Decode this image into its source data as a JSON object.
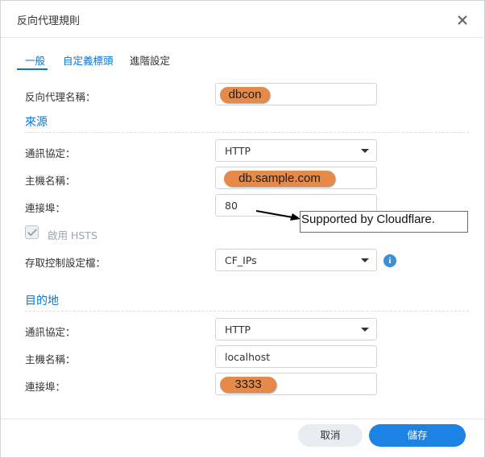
{
  "dialog": {
    "title": "反向代理規則",
    "close_icon": "close-icon"
  },
  "tabs": [
    {
      "label": "一般",
      "active": true
    },
    {
      "label": "自定義標頭",
      "active": false
    },
    {
      "label": "進階設定",
      "active": false
    }
  ],
  "general": {
    "name_label": "反向代理名稱：",
    "name_value": "dbcon"
  },
  "source": {
    "section_title": "來源",
    "protocol_label": "通訊協定：",
    "protocol_value": "HTTP",
    "hostname_label": "主機名稱：",
    "hostname_value": "db.sample.com",
    "port_label": "連接埠：",
    "port_value": "80",
    "hsts_label": "啟用 HSTS",
    "hsts_checked": true,
    "hsts_disabled": true,
    "acl_label": "存取控制設定檔：",
    "acl_value": "CF_IPs",
    "info_icon": "info-icon"
  },
  "destination": {
    "section_title": "目的地",
    "protocol_label": "通訊協定：",
    "protocol_value": "HTTP",
    "hostname_label": "主機名稱：",
    "hostname_value": "localhost",
    "port_label": "連接埠：",
    "port_value": "3333"
  },
  "annotation": {
    "text": "Supported by Cloudflare."
  },
  "buttons": {
    "cancel_label": "取消",
    "save_label": "儲存"
  },
  "colors": {
    "accent": "#0a76d1",
    "primary_button": "#1c82e4",
    "highlight": "#e58a48"
  }
}
